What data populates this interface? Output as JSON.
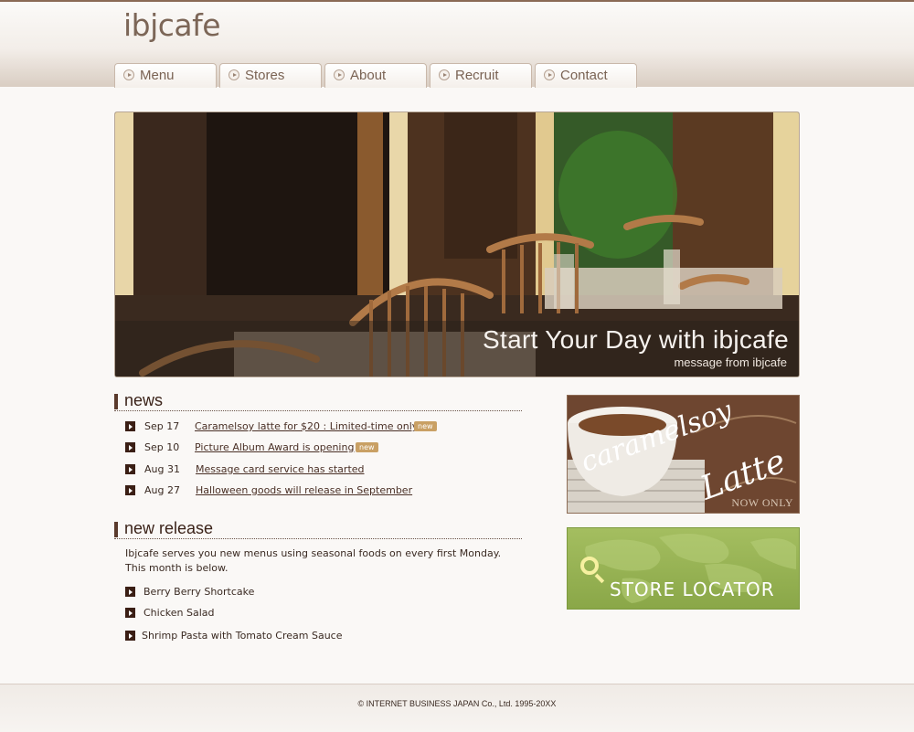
{
  "site": {
    "logo": "ibjcafe"
  },
  "nav": {
    "items": [
      {
        "label": "Menu"
      },
      {
        "label": "Stores"
      },
      {
        "label": "About"
      },
      {
        "label": "Recruit"
      },
      {
        "label": "Contact"
      }
    ]
  },
  "hero": {
    "title": "Start Your Day with ibjcafe",
    "subtitle": "message from ibjcafe"
  },
  "news": {
    "heading": "news",
    "items": [
      {
        "date": "Sep 17",
        "text": "Caramelsoy latte for $20 : Limited-time only",
        "badge": "new"
      },
      {
        "date": "Sep 10",
        "text": "Picture Album Award is opening",
        "badge": "new"
      },
      {
        "date": "Aug 31",
        "text": "Message card service has started"
      },
      {
        "date": "Aug 27",
        "text": "Halloween goods will release in September"
      }
    ]
  },
  "new_release": {
    "heading": "new release",
    "intro_line1": "Ibjcafe serves you new menus using seasonal foods on every first Monday.",
    "intro_line2": "This month is below.",
    "items": [
      {
        "label": "Berry Berry Shortcake"
      },
      {
        "label": "Chicken Salad"
      },
      {
        "label": "Shrimp Pasta with Tomato Cream Sauce"
      }
    ]
  },
  "promo": {
    "line1": "caramelsoy",
    "line2": "Latte",
    "tag": "NOW ONLY"
  },
  "locator": {
    "label": "STORE LOCATOR"
  },
  "footer": {
    "copyright": "© INTERNET BUSINESS JAPAN Co., Ltd. 1995-20XX"
  }
}
